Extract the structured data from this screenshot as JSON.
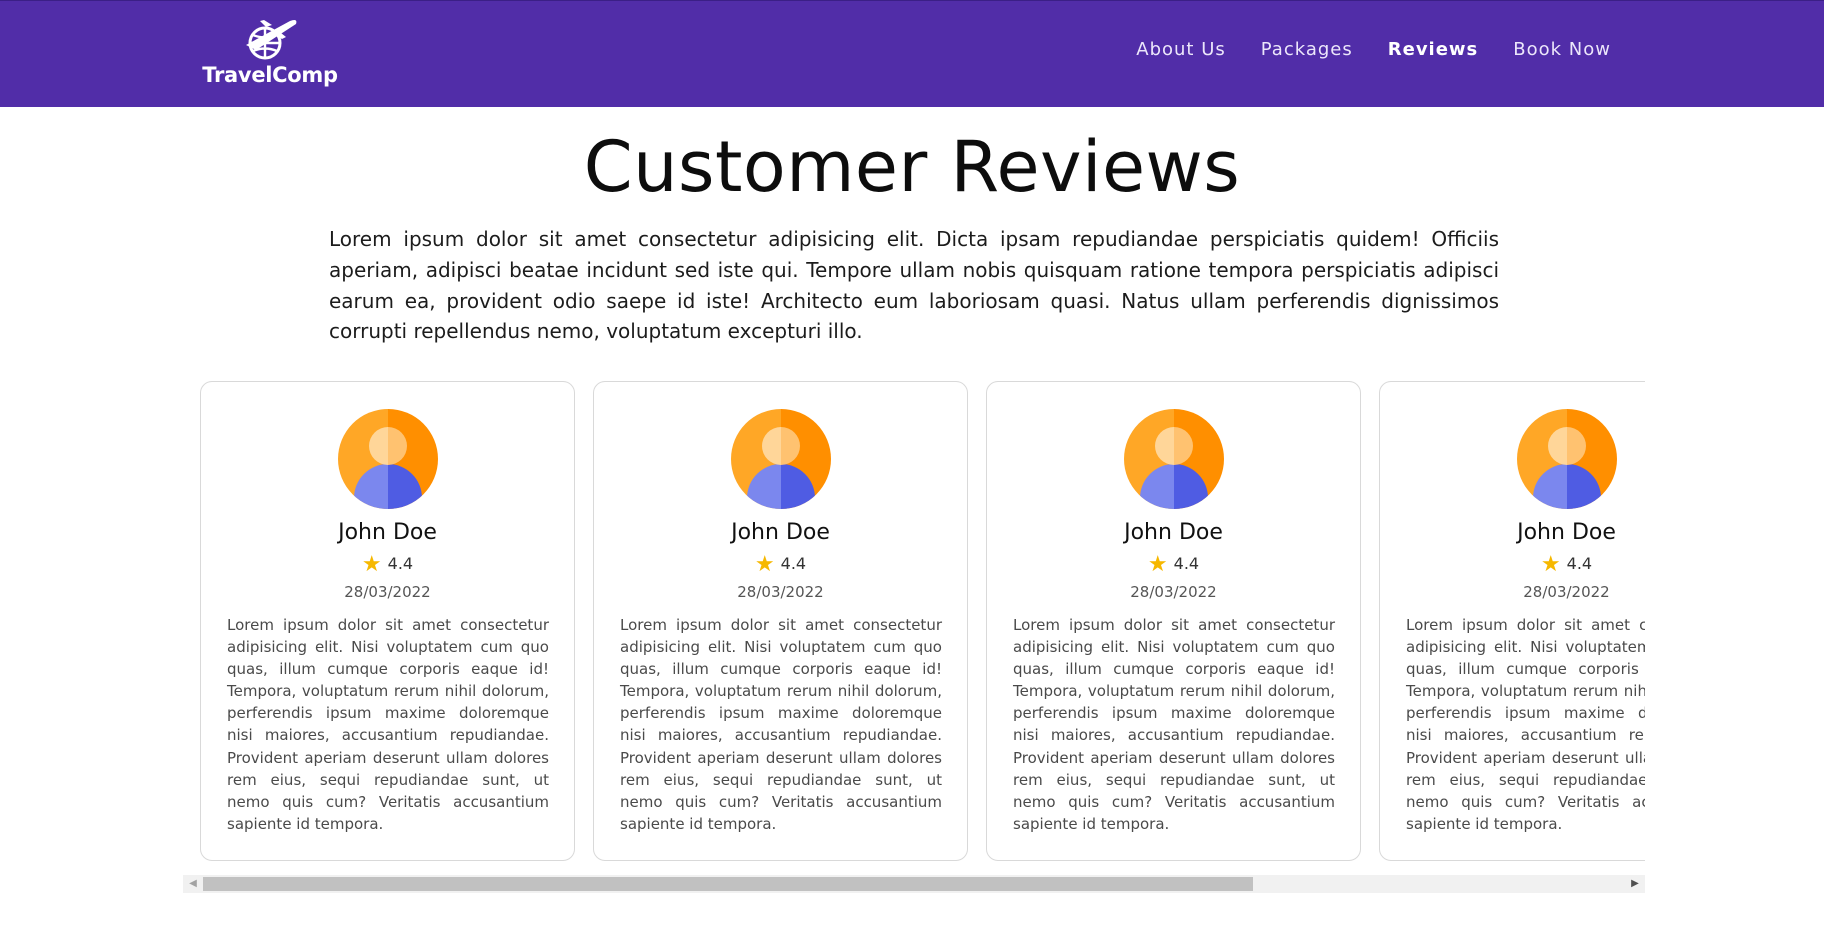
{
  "header": {
    "brand": "TravelComp",
    "nav": [
      {
        "label": "About Us",
        "active": false
      },
      {
        "label": "Packages",
        "active": false
      },
      {
        "label": "Reviews",
        "active": true
      },
      {
        "label": "Book Now",
        "active": false
      }
    ],
    "background_color": "#512da8"
  },
  "main": {
    "title": "Customer Reviews",
    "intro": "Lorem ipsum dolor sit amet consectetur adipisicing elit. Dicta ipsam repudiandae perspiciatis quidem! Officiis aperiam, adipisci beatae incidunt sed iste qui. Tempore ullam nobis quisquam ratione tempora perspiciatis adipisci earum ea, provident odio saepe id iste! Architecto eum laboriosam quasi. Natus ullam perferendis dignissimos corrupti repellendus nemo, voluptatum excepturi illo."
  },
  "reviews": [
    {
      "name": "John Doe",
      "rating": "4.4",
      "date": "28/03/2022",
      "text": "Lorem ipsum dolor sit amet consectetur adipisicing elit. Nisi voluptatem cum quo quas, illum cumque corporis eaque id! Tempora, voluptatum rerum nihil dolorum, perferendis ipsum maxime doloremque nisi maiores, accusantium repudiandae. Provident aperiam deserunt ullam dolores rem eius, sequi repudiandae sunt, ut nemo quis cum? Veritatis accusantium sapiente id tempora."
    },
    {
      "name": "John Doe",
      "rating": "4.4",
      "date": "28/03/2022",
      "text": "Lorem ipsum dolor sit amet consectetur adipisicing elit. Nisi voluptatem cum quo quas, illum cumque corporis eaque id! Tempora, voluptatum rerum nihil dolorum, perferendis ipsum maxime doloremque nisi maiores, accusantium repudiandae. Provident aperiam deserunt ullam dolores rem eius, sequi repudiandae sunt, ut nemo quis cum? Veritatis accusantium sapiente id tempora."
    },
    {
      "name": "John Doe",
      "rating": "4.4",
      "date": "28/03/2022",
      "text": "Lorem ipsum dolor sit amet consectetur adipisicing elit. Nisi voluptatem cum quo quas, illum cumque corporis eaque id! Tempora, voluptatum rerum nihil dolorum, perferendis ipsum maxime doloremque nisi maiores, accusantium repudiandae. Provident aperiam deserunt ullam dolores rem eius, sequi repudiandae sunt, ut nemo quis cum? Veritatis accusantium sapiente id tempora."
    },
    {
      "name": "John Doe",
      "rating": "4.4",
      "date": "28/03/2022",
      "text": "Lorem ipsum dolor sit amet consectetur adipisicing elit. Nisi voluptatem cum quo quas, illum cumque corporis eaque id! Tempora, voluptatum rerum nihil dolorum, perferendis ipsum maxime doloremque nisi maiores, accusantium repudiandae. Provident aperiam deserunt ullam dolores rem eius, sequi repudiandae sunt, ut nemo quis cum? Veritatis accusantium sapiente id tempora."
    }
  ],
  "icons": {
    "logo": "airplane-globe-logo-icon",
    "avatar": "user-avatar-icon",
    "star": "star-icon",
    "scroll_left": "scroll-left-arrow-icon",
    "scroll_right": "scroll-right-arrow-icon"
  },
  "colors": {
    "star": "#f6b800",
    "avatar_orange": "#ff9800",
    "avatar_blue": "#5b67e6"
  }
}
